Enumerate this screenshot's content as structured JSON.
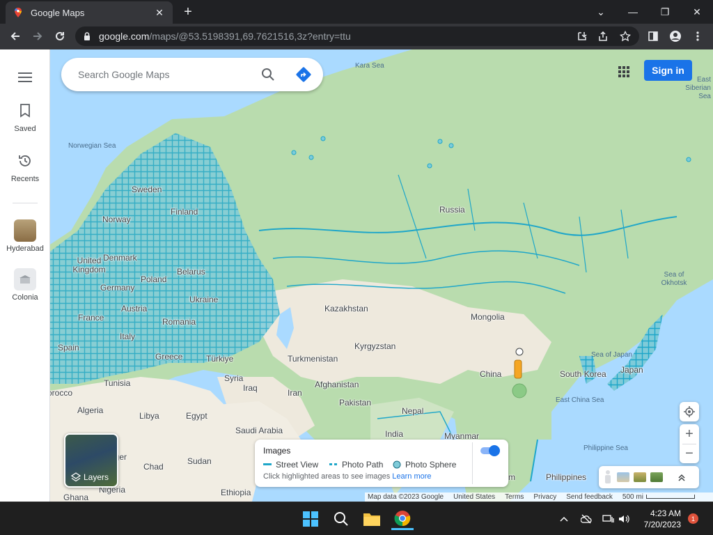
{
  "browser": {
    "tab_title": "Google Maps",
    "tab_close": "✕",
    "new_tab": "+",
    "url_host": "google.com",
    "url_path": "/maps/@53.5198391,69.7621516,3z?entry=ttu",
    "window_controls": [
      "⌄",
      "—",
      "❐",
      "✕"
    ]
  },
  "rail": {
    "menu_icon": "hamburger-menu-icon",
    "saved_label": "Saved",
    "recents_label": "Recents",
    "recent_places": [
      {
        "label": "Hyderabad"
      },
      {
        "label": "Colonia"
      }
    ]
  },
  "search": {
    "placeholder": "Search Google Maps"
  },
  "header": {
    "signin_label": "Sign in"
  },
  "map": {
    "country_labels": [
      "Russia",
      "Kazakhstan",
      "Mongolia",
      "China",
      "Kyrgyzstan",
      "Turkmenistan",
      "Afghanistan",
      "Iran",
      "Iraq",
      "Syria",
      "Pakistan",
      "India",
      "Nepal",
      "Myanmar",
      "South Korea",
      "Japan",
      "Finland",
      "Sweden",
      "Norway",
      "Denmark",
      "United Kingdom",
      "Germany",
      "Poland",
      "Belarus",
      "Ukraine",
      "Austria",
      "France",
      "Romania",
      "Italy",
      "Greece",
      "Türkiye",
      "Spain",
      "Tunisia",
      "Algeria",
      "Libya",
      "Egypt",
      "Saudi Arabia",
      "Chad",
      "Sudan",
      "Nigeria",
      "Ethiopia",
      "Philippines",
      "Vietnam",
      "Ghana",
      "Morocco",
      "Niger"
    ],
    "sea_labels": [
      "Kara Sea",
      "Norwegian Sea",
      "Sea of Okhotsk",
      "Sea of Japan",
      "East China Sea",
      "Philippine Sea",
      "East Siberian Sea"
    ]
  },
  "layers": {
    "label": "Layers"
  },
  "images_panel": {
    "title": "Images",
    "legend": [
      "Street View",
      "Photo Path",
      "Photo Sphere"
    ],
    "hint": "Click highlighted areas to see images",
    "learn_more": "Learn more",
    "toggle_on": true
  },
  "footer": {
    "map_data": "Map data ©2023 Google",
    "region": "United States",
    "terms": "Terms",
    "privacy": "Privacy",
    "feedback": "Send feedback",
    "scale": "500 mi"
  },
  "taskbar": {
    "time": "4:23 AM",
    "date": "7/20/2023",
    "notification_count": "1"
  },
  "colors": {
    "accent": "#1a73e8",
    "streetview": "#1ea6c9",
    "land": "#e8eddf",
    "forest": "#b5d9a8",
    "water": "#aadaff"
  }
}
